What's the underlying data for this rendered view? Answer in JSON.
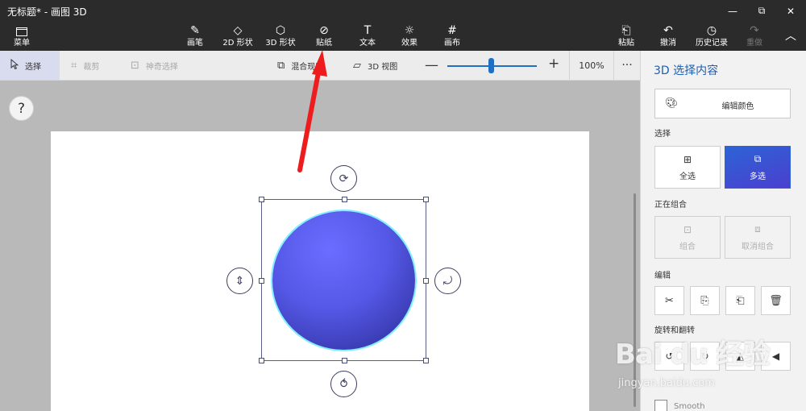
{
  "window": {
    "title": "无标题* - 画图 3D",
    "minimize": "—",
    "maximize": "⧉",
    "close": "✕"
  },
  "ribbon": {
    "menu": {
      "label": "菜单",
      "icon": "folder-icon"
    },
    "tools": [
      {
        "label": "画笔",
        "icon": "brush-icon",
        "glyph": "✎"
      },
      {
        "label": "2D 形状",
        "icon": "2d-shapes-icon",
        "glyph": "◇"
      },
      {
        "label": "3D 形状",
        "icon": "3d-shapes-icon",
        "glyph": "⬡"
      },
      {
        "label": "贴纸",
        "icon": "stickers-icon",
        "glyph": "⊘"
      },
      {
        "label": "文本",
        "icon": "text-icon",
        "glyph": "T"
      },
      {
        "label": "效果",
        "icon": "effects-icon",
        "glyph": "☼"
      },
      {
        "label": "画布",
        "icon": "canvas-icon",
        "glyph": "#"
      }
    ],
    "actions": [
      {
        "label": "粘贴",
        "icon": "paste-icon",
        "glyph": "⎗"
      },
      {
        "label": "撤消",
        "icon": "undo-icon",
        "glyph": "↶"
      },
      {
        "label": "历史记录",
        "icon": "history-icon",
        "glyph": "◷"
      },
      {
        "label": "重做",
        "icon": "redo-icon",
        "glyph": "↷"
      }
    ],
    "collapse_glyph": "︿"
  },
  "toolbar": {
    "select": "选择",
    "crop": "裁剪",
    "magic_select": "神奇选择",
    "mixed_reality": "混合现实",
    "view_3d": "3D 视图",
    "zoom_minus": "—",
    "zoom_plus": "+",
    "zoom_value": 65,
    "zoom_percent": "100%",
    "more": "···"
  },
  "canvas": {
    "help": "?"
  },
  "panel": {
    "title": "3D 选择内容",
    "edit_color": "编辑颜色",
    "select_section": "选择",
    "select_all": "全选",
    "multi_select": "多选",
    "grouping_section": "正在组合",
    "group": "组合",
    "ungroup": "取消组合",
    "edit_section": "编辑",
    "rotate_section": "旋转和翻转",
    "smooth": "Smooth"
  },
  "watermark": {
    "brand": "Bai du 经验",
    "url": "jingyan.baidu.com"
  },
  "colors": {
    "accent": "#1c5fb4",
    "titlebar": "#2b2b2b",
    "sphere": "#5558e6",
    "arrow": "#ee1c1c"
  }
}
